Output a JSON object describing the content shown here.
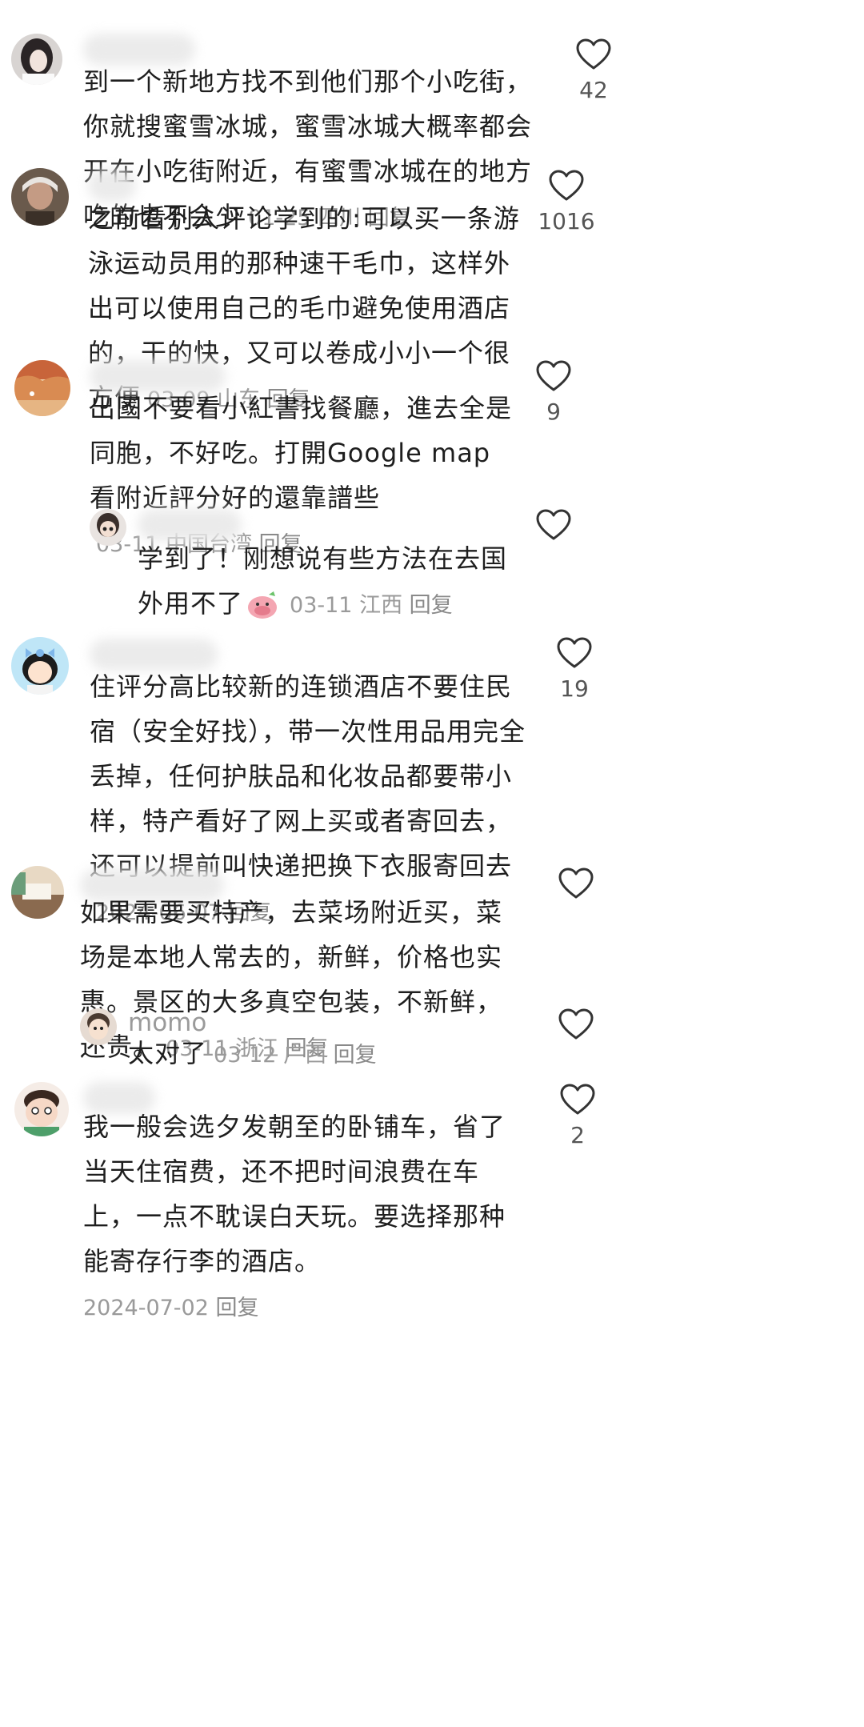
{
  "comments": [
    {
      "name": "",
      "text": "到一个新地方找不到他们那个小吃街，你就搜蜜雪冰城，蜜雪冰城大概率都会开在小吃街附近，有蜜雪冰城在的地方吃的也不会少",
      "date": "01-25",
      "location": "四川",
      "reply": "回复",
      "likes": "42"
    },
    {
      "name": "",
      "text": "之前看别人评论学到的:可以买一条游泳运动员用的那种速干毛巾，这样外出可以使用自己的毛巾避免使用酒店的，干的快，又可以卷成小小一个很方便",
      "date": "03-09",
      "location": "山东",
      "reply": "回复",
      "likes": "1016"
    },
    {
      "name": "",
      "text": "出國不要看小紅書找餐廳，進去全是同胞，不好吃。打開Google map看附近評分好的還靠譜些",
      "date": "03-11",
      "location": "中国台湾",
      "reply": "回复",
      "likes": "9"
    },
    {
      "name": "",
      "text": "学到了！刚想说有些方法在去国外用不了",
      "date": "03-11",
      "location": "江西",
      "reply": "回复",
      "likes": ""
    },
    {
      "name": "",
      "text": "住评分高比较新的连锁酒店不要住民宿（安全好找），带一次性用品用完全丢掉，任何护肤品和化妆品都要带小样，特产看好了网上买或者寄回去，还可以提前叫快递把换下衣服寄回去",
      "date": "2024-06-07",
      "location": "",
      "reply": "回复",
      "likes": "19"
    },
    {
      "name": "",
      "text": "如果需要买特产，去菜场附近买，菜场是本地人常去的，新鲜，价格也实惠。景区的大多真空包装，不新鲜，还贵。",
      "date": "03-11",
      "location": "浙江",
      "reply": "回复",
      "likes": ""
    },
    {
      "name": "momo",
      "text": "太对了",
      "date": "03-12",
      "location": "广西",
      "reply": "回复",
      "likes": ""
    },
    {
      "name": "",
      "text": "我一般会选夕发朝至的卧铺车，省了当天住宿费，还不把时间浪费在车上，一点不耽误白天玩。要选择那种能寄存行李的酒店。",
      "date": "2024-07-02",
      "location": "",
      "reply": "回复",
      "likes": "2"
    }
  ],
  "colors": {
    "heart_stroke": "#333333",
    "meta": "#9a9a9a"
  }
}
